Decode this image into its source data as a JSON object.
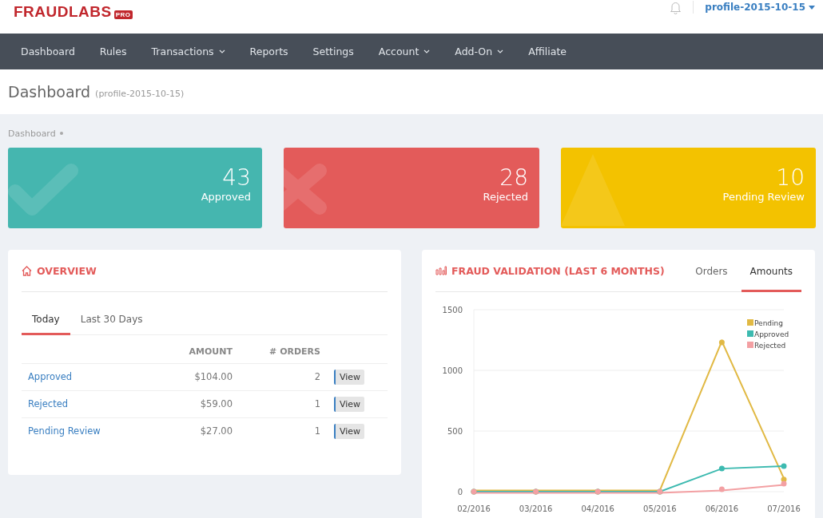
{
  "brand": {
    "name": "FRAUDLABS",
    "badge": "PRO"
  },
  "user": {
    "name": "profile-2015-10-15"
  },
  "nav": [
    {
      "label": "Dashboard",
      "dropdown": false
    },
    {
      "label": "Rules",
      "dropdown": false
    },
    {
      "label": "Transactions",
      "dropdown": true
    },
    {
      "label": "Reports",
      "dropdown": false
    },
    {
      "label": "Settings",
      "dropdown": false
    },
    {
      "label": "Account",
      "dropdown": true
    },
    {
      "label": "Add-On",
      "dropdown": true
    },
    {
      "label": "Affiliate",
      "dropdown": false
    }
  ],
  "page": {
    "title": "Dashboard",
    "subtitle": "(profile-2015-10-15)",
    "breadcrumb": "Dashboard"
  },
  "stats": [
    {
      "kind": "check",
      "value": "43",
      "label": "Approved",
      "color": "#45b6af"
    },
    {
      "kind": "cross",
      "value": "28",
      "label": "Rejected",
      "color": "#e35b5a"
    },
    {
      "kind": "warning",
      "value": "10",
      "label": "Pending Review",
      "color": "#f3c200"
    }
  ],
  "overview": {
    "title": "OVERVIEW",
    "tabs": [
      {
        "label": "Today",
        "selected": true
      },
      {
        "label": "Last 30 Days",
        "selected": false
      }
    ],
    "columns": [
      "AMOUNT",
      "# ORDERS"
    ],
    "rows": [
      {
        "status": "Approved",
        "amount": "$104.00",
        "orders": "2",
        "action": "View"
      },
      {
        "status": "Rejected",
        "amount": "$59.00",
        "orders": "1",
        "action": "View"
      },
      {
        "status": "Pending Review",
        "amount": "$27.00",
        "orders": "1",
        "action": "View"
      }
    ]
  },
  "fraud": {
    "title": "FRAUD VALIDATION (LAST 6 MONTHS)",
    "tabs": [
      {
        "label": "Orders",
        "selected": false
      },
      {
        "label": "Amounts",
        "selected": true
      }
    ],
    "chart_data": {
      "type": "line",
      "categories": [
        "02/2016",
        "03/2016",
        "04/2016",
        "05/2016",
        "06/2016",
        "07/2016"
      ],
      "series": [
        {
          "name": "Pending",
          "color": "#e1b944",
          "marker": "circle",
          "values": [
            0,
            0,
            0,
            0,
            1230,
            100
          ]
        },
        {
          "name": "Approved",
          "color": "#3dbab0",
          "marker": "circle",
          "values": [
            0,
            0,
            0,
            0,
            190,
            210
          ]
        },
        {
          "name": "Rejected",
          "color": "#f3a0a3",
          "marker": "circle",
          "values": [
            0,
            0,
            0,
            0,
            20,
            65
          ]
        }
      ],
      "legend": true,
      "ylim": [
        0,
        1500
      ],
      "yticks": [
        0,
        500,
        1000,
        1500
      ]
    }
  }
}
